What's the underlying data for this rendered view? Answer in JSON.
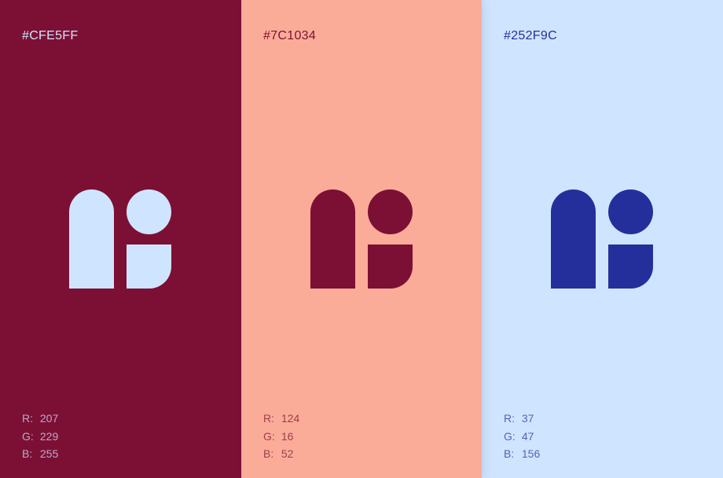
{
  "swatches": [
    {
      "hex": "#CFE5FF",
      "background": "#7C1034",
      "foreground": "#CFE5FF",
      "logo_icon": "abstract-logo-mark",
      "rgb": {
        "r_label": "R:",
        "r": "207",
        "g_label": "G:",
        "g": "229",
        "b_label": "B:",
        "b": "255"
      }
    },
    {
      "hex": "#7C1034",
      "background": "#FBAC98",
      "foreground": "#7C1034",
      "logo_icon": "abstract-logo-mark",
      "rgb": {
        "r_label": "R:",
        "r": "124",
        "g_label": "G:",
        "g": "16",
        "b_label": "B:",
        "b": "52"
      }
    },
    {
      "hex": "#252F9C",
      "background": "#CFE5FF",
      "foreground": "#252F9C",
      "logo_icon": "abstract-logo-mark",
      "rgb": {
        "r_label": "R:",
        "r": "37",
        "g_label": "G:",
        "g": "47",
        "b_label": "B:",
        "b": "156"
      }
    }
  ]
}
